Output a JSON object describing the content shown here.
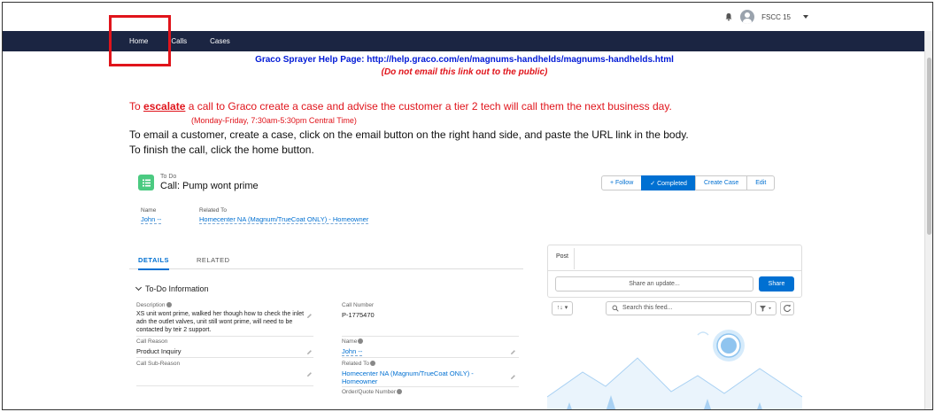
{
  "header": {
    "user_name": "FSCC 15",
    "nav": [
      "Home",
      "Calls",
      "Cases"
    ]
  },
  "banner": {
    "help_link": "Graco Sprayer Help Page: http://help.graco.com/en/magnums-handhelds/magnums-handhelds.html",
    "help_note": "(Do not email this link out to the public)",
    "escalate_prefix": "To ",
    "escalate_keyword": "escalate",
    "escalate_rest": " a call to Graco create a case and advise the customer a tier 2 tech will call them the next business day.",
    "hours": "(Monday-Friday, 7:30am-5:30pm Central Time)",
    "email_instruction": "To email a customer, create a case, click on the email button on the right hand side, and paste the URL link in the body.",
    "finish_instruction": "To finish the call, click the home button."
  },
  "record": {
    "type_label": "To Do",
    "title": "Call: Pump wont prime",
    "actions": [
      "+ Follow",
      "✓ Completed",
      "Create Case",
      "Edit"
    ],
    "name_header": "Name",
    "name_value": "John --",
    "related_header": "Related To",
    "related_value": "Homecenter NA (Magnum/TrueCoat ONLY) - Homeowner"
  },
  "tabs": [
    "DETAILS",
    "RELATED"
  ],
  "details": {
    "section_title": "To-Do Information",
    "description_label": "Description",
    "description_value": "XS unit wont prime, walked her though how to check the inlet adn the outlet valves, unit still wont prime, will need to be contacted by teir 2 support.",
    "call_number_label": "Call Number",
    "call_number_value": "P-1775470",
    "call_reason_label": "Call Reason",
    "call_reason_value": "Product Inquiry",
    "name_label": "Name",
    "name_value": "John --",
    "call_sub_reason_label": "Call Sub-Reason",
    "related_to_label": "Related To",
    "related_to_value": "Homecenter NA (Magnum/TrueCoat ONLY) - Homeowner",
    "order_quote_label": "Order/Quote Number"
  },
  "feed": {
    "post_tab": "Post",
    "share_placeholder": "Share an update...",
    "share_button": "Share",
    "sort_label": "↑↓ ▾",
    "search_placeholder": "Search this feed..."
  },
  "colors": {
    "nav_bg": "#1b2542",
    "brand": "#0070d2",
    "alert_red": "#e0141b",
    "link_blue": "#0019d6"
  }
}
